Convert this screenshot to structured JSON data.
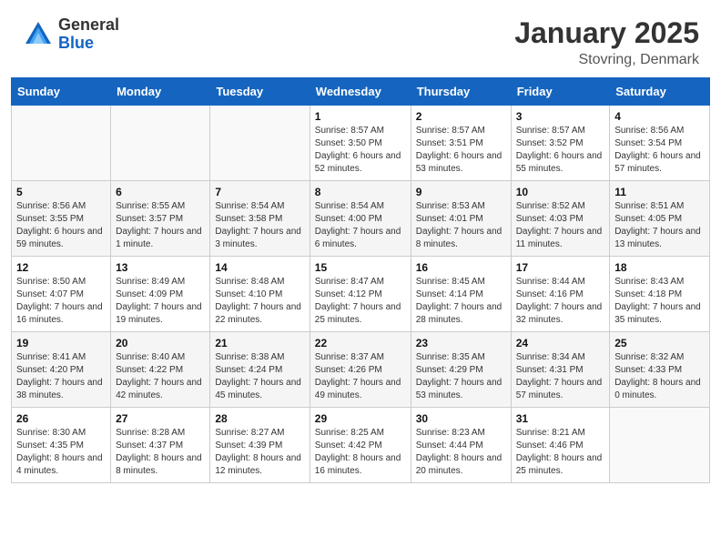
{
  "header": {
    "logo_general": "General",
    "logo_blue": "Blue",
    "month_year": "January 2025",
    "location": "Stovring, Denmark"
  },
  "days_of_week": [
    "Sunday",
    "Monday",
    "Tuesday",
    "Wednesday",
    "Thursday",
    "Friday",
    "Saturday"
  ],
  "weeks": [
    [
      {
        "day": "",
        "sunrise": "",
        "sunset": "",
        "daylight": ""
      },
      {
        "day": "",
        "sunrise": "",
        "sunset": "",
        "daylight": ""
      },
      {
        "day": "",
        "sunrise": "",
        "sunset": "",
        "daylight": ""
      },
      {
        "day": "1",
        "sunrise": "Sunrise: 8:57 AM",
        "sunset": "Sunset: 3:50 PM",
        "daylight": "Daylight: 6 hours and 52 minutes."
      },
      {
        "day": "2",
        "sunrise": "Sunrise: 8:57 AM",
        "sunset": "Sunset: 3:51 PM",
        "daylight": "Daylight: 6 hours and 53 minutes."
      },
      {
        "day": "3",
        "sunrise": "Sunrise: 8:57 AM",
        "sunset": "Sunset: 3:52 PM",
        "daylight": "Daylight: 6 hours and 55 minutes."
      },
      {
        "day": "4",
        "sunrise": "Sunrise: 8:56 AM",
        "sunset": "Sunset: 3:54 PM",
        "daylight": "Daylight: 6 hours and 57 minutes."
      }
    ],
    [
      {
        "day": "5",
        "sunrise": "Sunrise: 8:56 AM",
        "sunset": "Sunset: 3:55 PM",
        "daylight": "Daylight: 6 hours and 59 minutes."
      },
      {
        "day": "6",
        "sunrise": "Sunrise: 8:55 AM",
        "sunset": "Sunset: 3:57 PM",
        "daylight": "Daylight: 7 hours and 1 minute."
      },
      {
        "day": "7",
        "sunrise": "Sunrise: 8:54 AM",
        "sunset": "Sunset: 3:58 PM",
        "daylight": "Daylight: 7 hours and 3 minutes."
      },
      {
        "day": "8",
        "sunrise": "Sunrise: 8:54 AM",
        "sunset": "Sunset: 4:00 PM",
        "daylight": "Daylight: 7 hours and 6 minutes."
      },
      {
        "day": "9",
        "sunrise": "Sunrise: 8:53 AM",
        "sunset": "Sunset: 4:01 PM",
        "daylight": "Daylight: 7 hours and 8 minutes."
      },
      {
        "day": "10",
        "sunrise": "Sunrise: 8:52 AM",
        "sunset": "Sunset: 4:03 PM",
        "daylight": "Daylight: 7 hours and 11 minutes."
      },
      {
        "day": "11",
        "sunrise": "Sunrise: 8:51 AM",
        "sunset": "Sunset: 4:05 PM",
        "daylight": "Daylight: 7 hours and 13 minutes."
      }
    ],
    [
      {
        "day": "12",
        "sunrise": "Sunrise: 8:50 AM",
        "sunset": "Sunset: 4:07 PM",
        "daylight": "Daylight: 7 hours and 16 minutes."
      },
      {
        "day": "13",
        "sunrise": "Sunrise: 8:49 AM",
        "sunset": "Sunset: 4:09 PM",
        "daylight": "Daylight: 7 hours and 19 minutes."
      },
      {
        "day": "14",
        "sunrise": "Sunrise: 8:48 AM",
        "sunset": "Sunset: 4:10 PM",
        "daylight": "Daylight: 7 hours and 22 minutes."
      },
      {
        "day": "15",
        "sunrise": "Sunrise: 8:47 AM",
        "sunset": "Sunset: 4:12 PM",
        "daylight": "Daylight: 7 hours and 25 minutes."
      },
      {
        "day": "16",
        "sunrise": "Sunrise: 8:45 AM",
        "sunset": "Sunset: 4:14 PM",
        "daylight": "Daylight: 7 hours and 28 minutes."
      },
      {
        "day": "17",
        "sunrise": "Sunrise: 8:44 AM",
        "sunset": "Sunset: 4:16 PM",
        "daylight": "Daylight: 7 hours and 32 minutes."
      },
      {
        "day": "18",
        "sunrise": "Sunrise: 8:43 AM",
        "sunset": "Sunset: 4:18 PM",
        "daylight": "Daylight: 7 hours and 35 minutes."
      }
    ],
    [
      {
        "day": "19",
        "sunrise": "Sunrise: 8:41 AM",
        "sunset": "Sunset: 4:20 PM",
        "daylight": "Daylight: 7 hours and 38 minutes."
      },
      {
        "day": "20",
        "sunrise": "Sunrise: 8:40 AM",
        "sunset": "Sunset: 4:22 PM",
        "daylight": "Daylight: 7 hours and 42 minutes."
      },
      {
        "day": "21",
        "sunrise": "Sunrise: 8:38 AM",
        "sunset": "Sunset: 4:24 PM",
        "daylight": "Daylight: 7 hours and 45 minutes."
      },
      {
        "day": "22",
        "sunrise": "Sunrise: 8:37 AM",
        "sunset": "Sunset: 4:26 PM",
        "daylight": "Daylight: 7 hours and 49 minutes."
      },
      {
        "day": "23",
        "sunrise": "Sunrise: 8:35 AM",
        "sunset": "Sunset: 4:29 PM",
        "daylight": "Daylight: 7 hours and 53 minutes."
      },
      {
        "day": "24",
        "sunrise": "Sunrise: 8:34 AM",
        "sunset": "Sunset: 4:31 PM",
        "daylight": "Daylight: 7 hours and 57 minutes."
      },
      {
        "day": "25",
        "sunrise": "Sunrise: 8:32 AM",
        "sunset": "Sunset: 4:33 PM",
        "daylight": "Daylight: 8 hours and 0 minutes."
      }
    ],
    [
      {
        "day": "26",
        "sunrise": "Sunrise: 8:30 AM",
        "sunset": "Sunset: 4:35 PM",
        "daylight": "Daylight: 8 hours and 4 minutes."
      },
      {
        "day": "27",
        "sunrise": "Sunrise: 8:28 AM",
        "sunset": "Sunset: 4:37 PM",
        "daylight": "Daylight: 8 hours and 8 minutes."
      },
      {
        "day": "28",
        "sunrise": "Sunrise: 8:27 AM",
        "sunset": "Sunset: 4:39 PM",
        "daylight": "Daylight: 8 hours and 12 minutes."
      },
      {
        "day": "29",
        "sunrise": "Sunrise: 8:25 AM",
        "sunset": "Sunset: 4:42 PM",
        "daylight": "Daylight: 8 hours and 16 minutes."
      },
      {
        "day": "30",
        "sunrise": "Sunrise: 8:23 AM",
        "sunset": "Sunset: 4:44 PM",
        "daylight": "Daylight: 8 hours and 20 minutes."
      },
      {
        "day": "31",
        "sunrise": "Sunrise: 8:21 AM",
        "sunset": "Sunset: 4:46 PM",
        "daylight": "Daylight: 8 hours and 25 minutes."
      },
      {
        "day": "",
        "sunrise": "",
        "sunset": "",
        "daylight": ""
      }
    ]
  ]
}
